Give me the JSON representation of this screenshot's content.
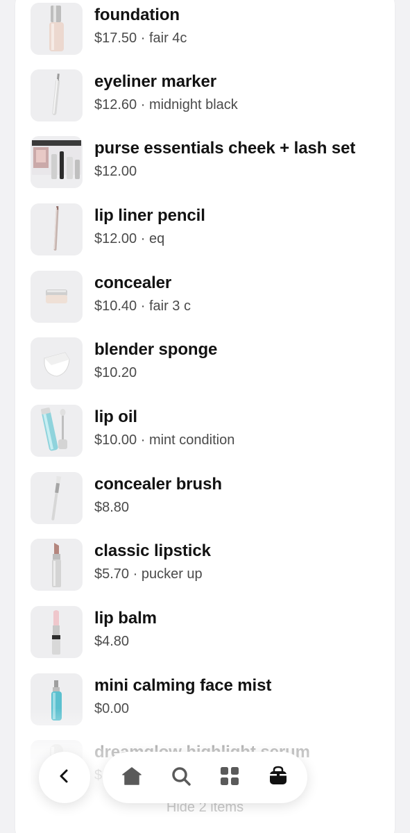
{
  "items": [
    {
      "name": "foundation",
      "price": "$17.50",
      "variant": "fair 4c",
      "subtitle": "$17.50 · fair 4c",
      "image": "foundation-bottle-image"
    },
    {
      "name": "eyeliner marker",
      "price": "$12.60",
      "variant": "midnight black",
      "subtitle": "$12.60 · midnight black",
      "image": "eyeliner-image"
    },
    {
      "name": "purse essentials cheek + lash set",
      "price": "$12.00",
      "variant": "",
      "subtitle": "$12.00",
      "image": "gift-set-image"
    },
    {
      "name": "lip liner pencil",
      "price": "$12.00",
      "variant": "eq",
      "subtitle": "$12.00 · eq",
      "image": "pencil-image"
    },
    {
      "name": "concealer",
      "price": "$10.40",
      "variant": "fair 3 c",
      "subtitle": "$10.40 · fair 3 c",
      "image": "concealer-jar-image"
    },
    {
      "name": "blender sponge",
      "price": "$10.20",
      "variant": "",
      "subtitle": "$10.20",
      "image": "sponge-image"
    },
    {
      "name": "lip oil",
      "price": "$10.00",
      "variant": "mint condition",
      "subtitle": "$10.00 · mint condition",
      "image": "lip-oil-image"
    },
    {
      "name": "concealer brush",
      "price": "$8.80",
      "variant": "",
      "subtitle": "$8.80",
      "image": "brush-image"
    },
    {
      "name": "classic lipstick",
      "price": "$5.70",
      "variant": "pucker up",
      "subtitle": "$5.70 · pucker up",
      "image": "lipstick-image"
    },
    {
      "name": "lip balm",
      "price": "$4.80",
      "variant": "",
      "subtitle": "$4.80",
      "image": "lip-balm-image"
    },
    {
      "name": "mini calming face mist",
      "price": "$0.00",
      "variant": "",
      "subtitle": "$0.00",
      "image": "face-mist-image"
    },
    {
      "name": "dreamglow highlight serum",
      "price": "$",
      "variant": "",
      "subtitle": "$",
      "image": "serum-image"
    }
  ],
  "footer": {
    "hide_label": "Hide 2 items"
  },
  "nav": {
    "back_icon": "chevron-left-icon",
    "buttons": [
      "home-icon",
      "search-icon",
      "grid-icon",
      "bag-icon"
    ]
  },
  "colors": {
    "background": "#f2f2f4",
    "card": "#ffffff",
    "thumb": "#eeeef0",
    "text": "#121212",
    "muted": "#4a4a4a",
    "icon": "#5a5a5a"
  }
}
